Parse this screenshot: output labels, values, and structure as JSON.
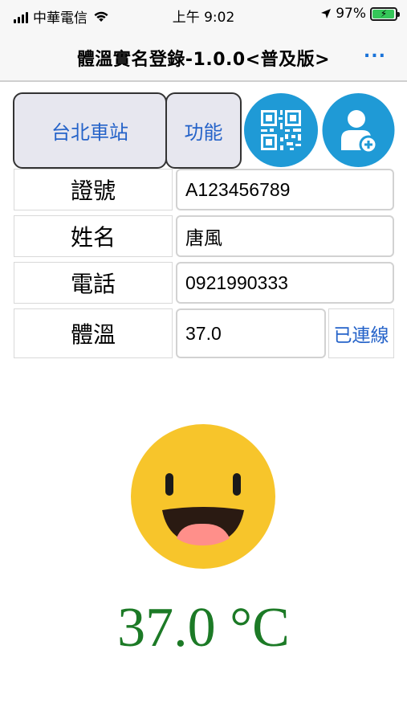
{
  "status_bar": {
    "carrier": "中華電信",
    "time": "上午 9:02",
    "battery_percent": "97%",
    "battery_level": 0.97
  },
  "nav": {
    "title": "體溫實名登錄-1.0.0<普及版>",
    "more": "..."
  },
  "toolbar": {
    "station_label": "台北車站",
    "function_label": "功能",
    "qr_icon": "qr-code-icon",
    "add_user_icon": "add-user-icon"
  },
  "form": {
    "id_label": "證號",
    "id_value": "A123456789",
    "name_label": "姓名",
    "name_value": "唐風",
    "phone_label": "電話",
    "phone_value": "0921990333",
    "temp_label": "體溫",
    "temp_value": "37.0",
    "connection_status": "已連線"
  },
  "display": {
    "face": "happy-face-icon",
    "temperature": "37.0 °C"
  },
  "colors": {
    "accent": "#2563c9",
    "button_bg": "#e7e7ef",
    "icon_circle": "#1f9ad6",
    "face": "#f7c52b",
    "temp_text": "#1c7a26",
    "battery": "#35c759"
  }
}
